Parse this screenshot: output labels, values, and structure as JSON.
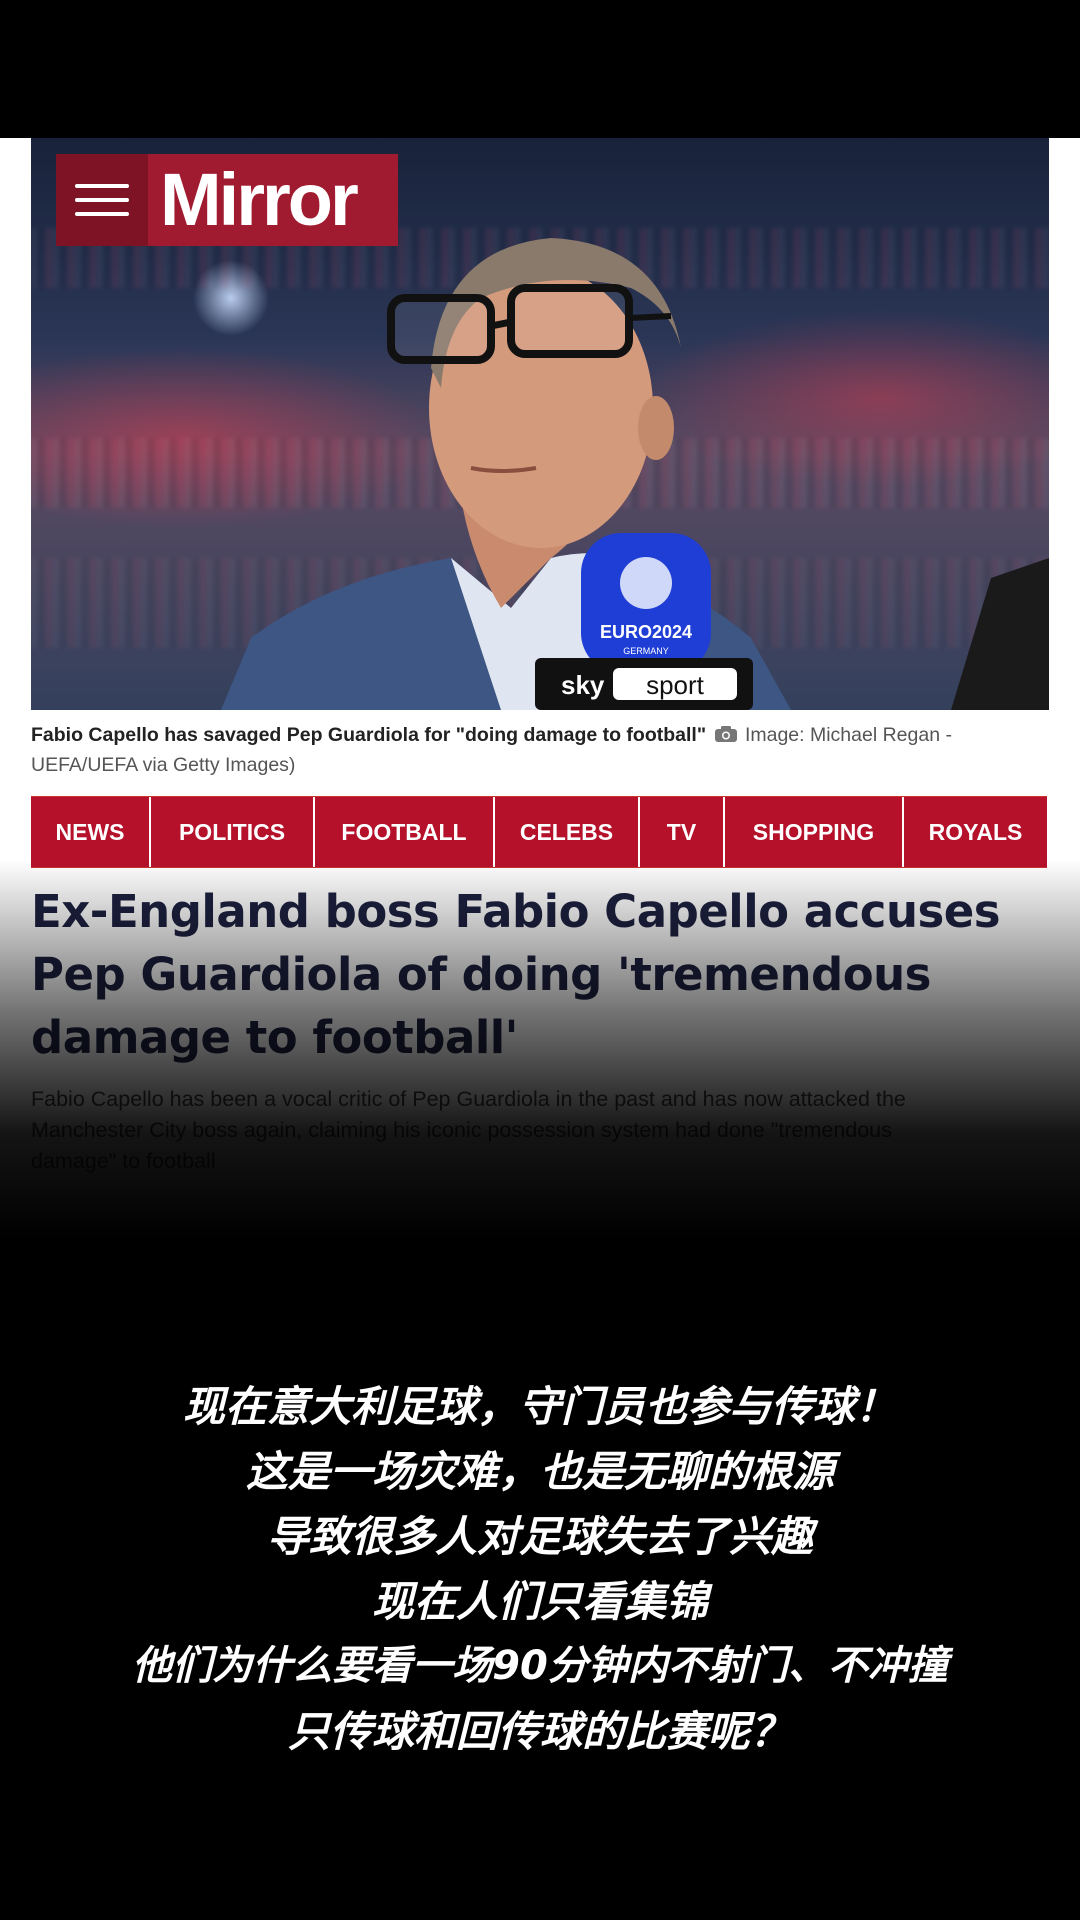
{
  "brand": {
    "logo_text": "Mirror",
    "color": "#a11b30"
  },
  "article": {
    "photo_alt": "Fabio Capello with Sky Sport EURO 2024 microphone",
    "mic_labels": {
      "event": "EURO2024",
      "host": "GERMANY",
      "broadcaster_a": "sky",
      "broadcaster_b": "sport"
    },
    "caption": {
      "text": "Fabio Capello has savaged Pep Guardiola for \"doing damage to football\"",
      "credit_line1": "Image: Michael Regan -",
      "credit_line2": "UEFA/UEFA via Getty Images)"
    },
    "nav": [
      "NEWS",
      "POLITICS",
      "FOOTBALL",
      "CELEBS",
      "TV",
      "SHOPPING",
      "ROYALS"
    ],
    "headline": {
      "line1": "Ex-England boss Fabio Capello accuses",
      "line2": "Pep Guardiola of doing 'tremendous",
      "line3": "damage to football'"
    },
    "standfirst": {
      "line1": "Fabio Capello has been a vocal critic of Pep Guardiola in the past and has now attacked the",
      "line2": "Manchester City boss again, claiming his iconic possession system had done \"tremendous",
      "line3": "damage\" to football"
    }
  },
  "subtitles": [
    "现在意大利足球，守门员也参与传球！",
    "这是一场灾难，也是无聊的根源",
    "导致很多人对足球失去了兴趣",
    "现在人们只看集锦",
    "他们为什么要看一场90分钟内不射门、不冲撞",
    "只传球和回传球的比赛呢？"
  ]
}
